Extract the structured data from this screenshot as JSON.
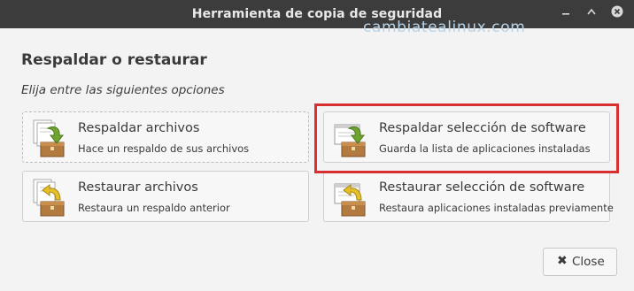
{
  "window": {
    "title": "Herramienta de copia de seguridad",
    "min_icon": "minimize-icon",
    "max_icon": "maximize-icon",
    "close_icon": "close-icon"
  },
  "watermark": "cambiatealinux.com",
  "main": {
    "heading": "Respaldar o restaurar",
    "subheading": "Elija entre las siguientes opciones"
  },
  "options": [
    {
      "title": "Respaldar archivos",
      "description": "Hace un respaldo de sus archivos",
      "icon": "backup-files-icon"
    },
    {
      "title": "Respaldar selección de software",
      "description": "Guarda la lista de aplicaciones instaladas",
      "icon": "backup-software-icon"
    },
    {
      "title": "Restaurar archivos",
      "description": "Restaura un respaldo anterior",
      "icon": "restore-files-icon"
    },
    {
      "title": "Restaurar selección de software",
      "description": "Restaura aplicaciones instaladas previamente",
      "icon": "restore-software-icon"
    }
  ],
  "footer": {
    "close_label": "Close",
    "close_symbol": "✖"
  },
  "colors": {
    "titlebar": "#3c3c3c",
    "highlight": "#d83030",
    "arrow_green": "#6fa431",
    "arrow_yellow": "#e6c02a",
    "box_brown": "#b27a3e"
  }
}
